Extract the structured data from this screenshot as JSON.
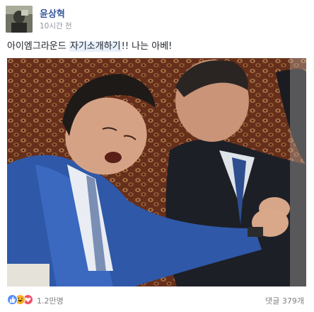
{
  "post": {
    "author": "윤상혁",
    "time": "10시간 전",
    "caption_before": "아이엠그라운드 ",
    "caption_highlight": "자기소개하기",
    "caption_after": "!! 나는 아베!",
    "photo": {
      "description_icon": "photo"
    }
  },
  "footer": {
    "reaction_icons": [
      "like-icon",
      "haha-icon",
      "love-icon"
    ],
    "reaction_count": "1.2만명",
    "comment_count": "댓글 379개"
  },
  "colors": {
    "author_link": "#365899",
    "meta_gray": "#90949c",
    "highlight": "#e8f0fb",
    "like_blue": "#5890ff",
    "haha_yellow": "#f7b125",
    "love_red": "#f25268"
  }
}
